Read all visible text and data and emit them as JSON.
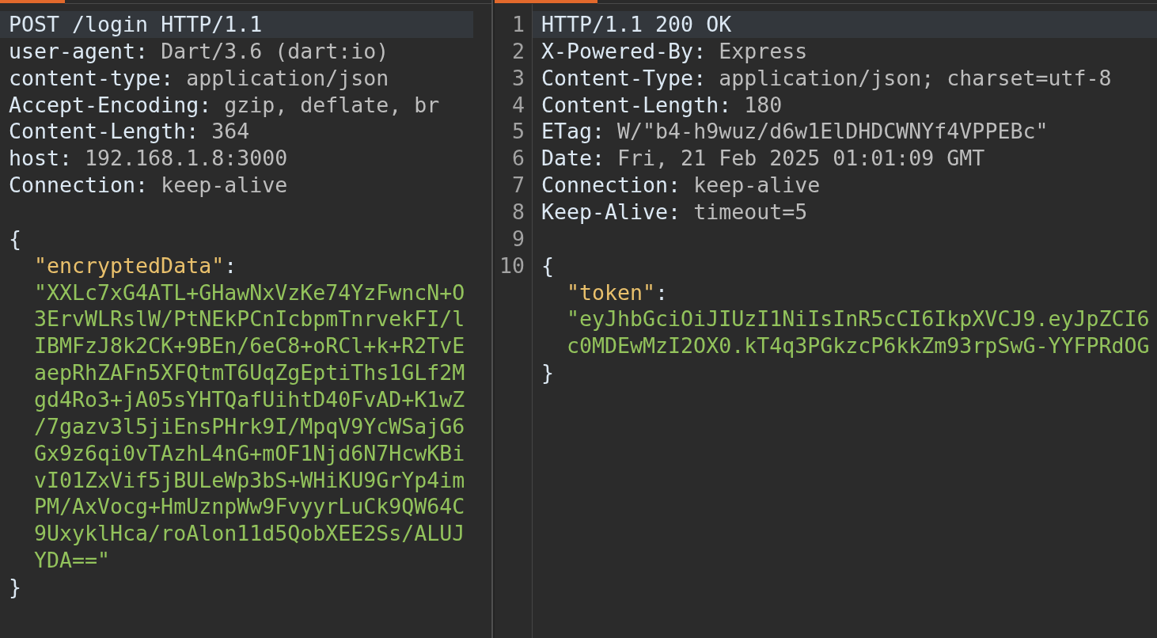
{
  "request": {
    "lines": [
      {
        "kind": "start_line",
        "text": "POST /login HTTP/1.1",
        "highlighted": true
      },
      {
        "kind": "header",
        "name": "user-agent:",
        "value": "Dart/3.6 (dart:io)",
        "highlighted": false
      },
      {
        "kind": "header",
        "name": "content-type:",
        "value": "application/json",
        "highlighted": false
      },
      {
        "kind": "header",
        "name": "Accept-Encoding:",
        "value": "gzip, deflate, br",
        "highlighted": false
      },
      {
        "kind": "header",
        "name": "Content-Length:",
        "value": "364",
        "highlighted": false
      },
      {
        "kind": "header",
        "name": "host:",
        "value": "192.168.1.8:3000",
        "highlighted": false
      },
      {
        "kind": "header",
        "name": "Connection:",
        "value": "keep-alive",
        "highlighted": false
      },
      {
        "kind": "blank",
        "highlighted": false
      },
      {
        "kind": "brace",
        "text": "{",
        "highlighted": false
      },
      {
        "kind": "json_key",
        "key": "\"encryptedData\"",
        "separator": ":",
        "highlighted": false
      },
      {
        "kind": "json_string",
        "value": "\"XXLc7xG4ATL+GHawNxVzKe74YzFwncN+O3ErvWLRslW/PtNEkPCnIcbpmTnrvekFI/lIBMFzJ8k2CK+9BEn/6eC8+oRCl+k+R2TvEaepRhZAFn5XFQtmT6UqZgEptiThs1GLf2Mgd4Ro3+jA05sYHTQafUihtD40FvAD+K1wZ/7gazv3l5jiEnsPHrk9I/MpqV9YcWSajG6Gx9z6qi0vTAzhL4nG+mOF1Njd6N7HcwKBivI01ZxVif5jBULeWp3bS+WHiKU9GrYp4imPM/AxVocg+HmUznpWw9FvyyrLuCk9QW64C9UxyklHca/roAlon11d5QobXEE2Ss/ALUJYDA==\"",
        "highlighted": false
      },
      {
        "kind": "brace",
        "text": "}",
        "highlighted": false
      }
    ]
  },
  "response": {
    "lines": [
      {
        "kind": "start_line",
        "number": "1",
        "text": "HTTP/1.1 200 OK",
        "highlighted": true
      },
      {
        "kind": "header",
        "number": "2",
        "name": "X-Powered-By:",
        "value": "Express",
        "highlighted": false
      },
      {
        "kind": "header",
        "number": "3",
        "name": "Content-Type:",
        "value": "application/json; charset=utf-8",
        "highlighted": false
      },
      {
        "kind": "header",
        "number": "4",
        "name": "Content-Length:",
        "value": "180",
        "highlighted": false
      },
      {
        "kind": "header",
        "number": "5",
        "name": "ETag:",
        "value": "W/\"b4-h9wuz/d6w1ElDHDCWNYf4VPPEBc\"",
        "highlighted": false
      },
      {
        "kind": "header",
        "number": "6",
        "name": "Date:",
        "value": "Fri, 21 Feb 2025 01:01:09 GMT",
        "highlighted": false
      },
      {
        "kind": "header",
        "number": "7",
        "name": "Connection:",
        "value": "keep-alive",
        "highlighted": false
      },
      {
        "kind": "header",
        "number": "8",
        "name": "Keep-Alive:",
        "value": "timeout=5",
        "highlighted": false
      },
      {
        "kind": "blank",
        "number": "9",
        "highlighted": false
      },
      {
        "kind": "brace",
        "number": "10",
        "text": "{",
        "highlighted": false
      },
      {
        "kind": "json_key",
        "key": "\"token\"",
        "separator": ":",
        "highlighted": false
      },
      {
        "kind": "json_string",
        "value": "\"eyJhbGciOiJIUzI1NiIsInR5cCI6IkpXVCJ9.eyJpZCI6",
        "highlighted": false
      },
      {
        "kind": "json_string",
        "value": "c0MDEwMzI2OX0.kT4q3PGkzcP6kkZm93rpSwG-YYFPRdOG",
        "highlighted": false
      },
      {
        "kind": "brace",
        "text": "}",
        "highlighted": false
      }
    ]
  }
}
